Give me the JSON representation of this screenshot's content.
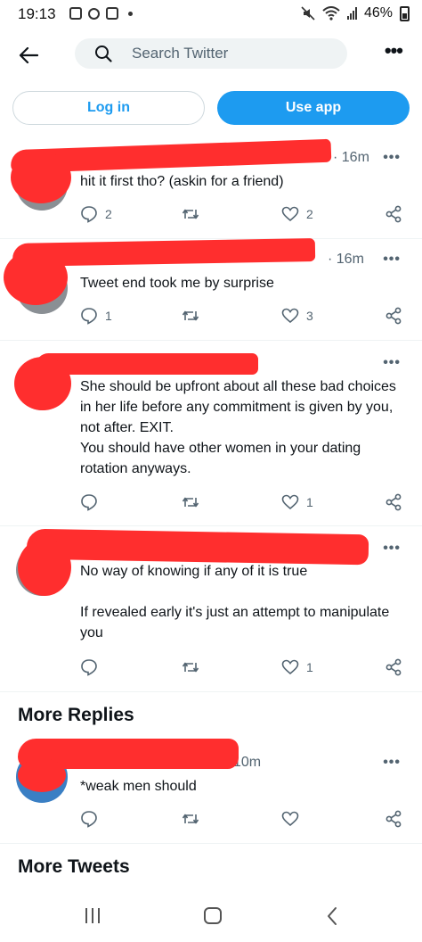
{
  "status_bar": {
    "time": "19:13",
    "battery": "46%"
  },
  "header": {
    "search_placeholder": "Search Twitter",
    "more_label": "•••"
  },
  "auth": {
    "login_label": "Log in",
    "use_app_label": "Use app"
  },
  "tweets": [
    {
      "time": "· 16m",
      "body": "hit it first tho? (askin for a friend)",
      "replies": "2",
      "retweets": "",
      "likes": "2"
    },
    {
      "time": "· 16m",
      "body": "Tweet end took me by surprise",
      "replies": "1",
      "retweets": "",
      "likes": "3"
    },
    {
      "time": "",
      "body": "She should be upfront about all these bad choices in her life before any commitment is given by you, not after. EXIT.\nYou should have other women in your dating rotation anyways.",
      "replies": "",
      "retweets": "",
      "likes": "1"
    },
    {
      "time": "",
      "body": "No way of knowing if any of it is true\n\nIf revealed early it's just an attempt to manipulate you",
      "replies": "",
      "retweets": "",
      "likes": "1"
    }
  ],
  "more_replies": {
    "title": "More Replies",
    "tweet": {
      "time": "10m",
      "body": "*weak men should",
      "replies": "",
      "retweets": "",
      "likes": ""
    }
  },
  "more_tweets": {
    "title": "More Tweets"
  },
  "colors": {
    "accent": "#1d9bf0",
    "redaction": "#ff2e2e",
    "secondary_text": "#536471"
  }
}
